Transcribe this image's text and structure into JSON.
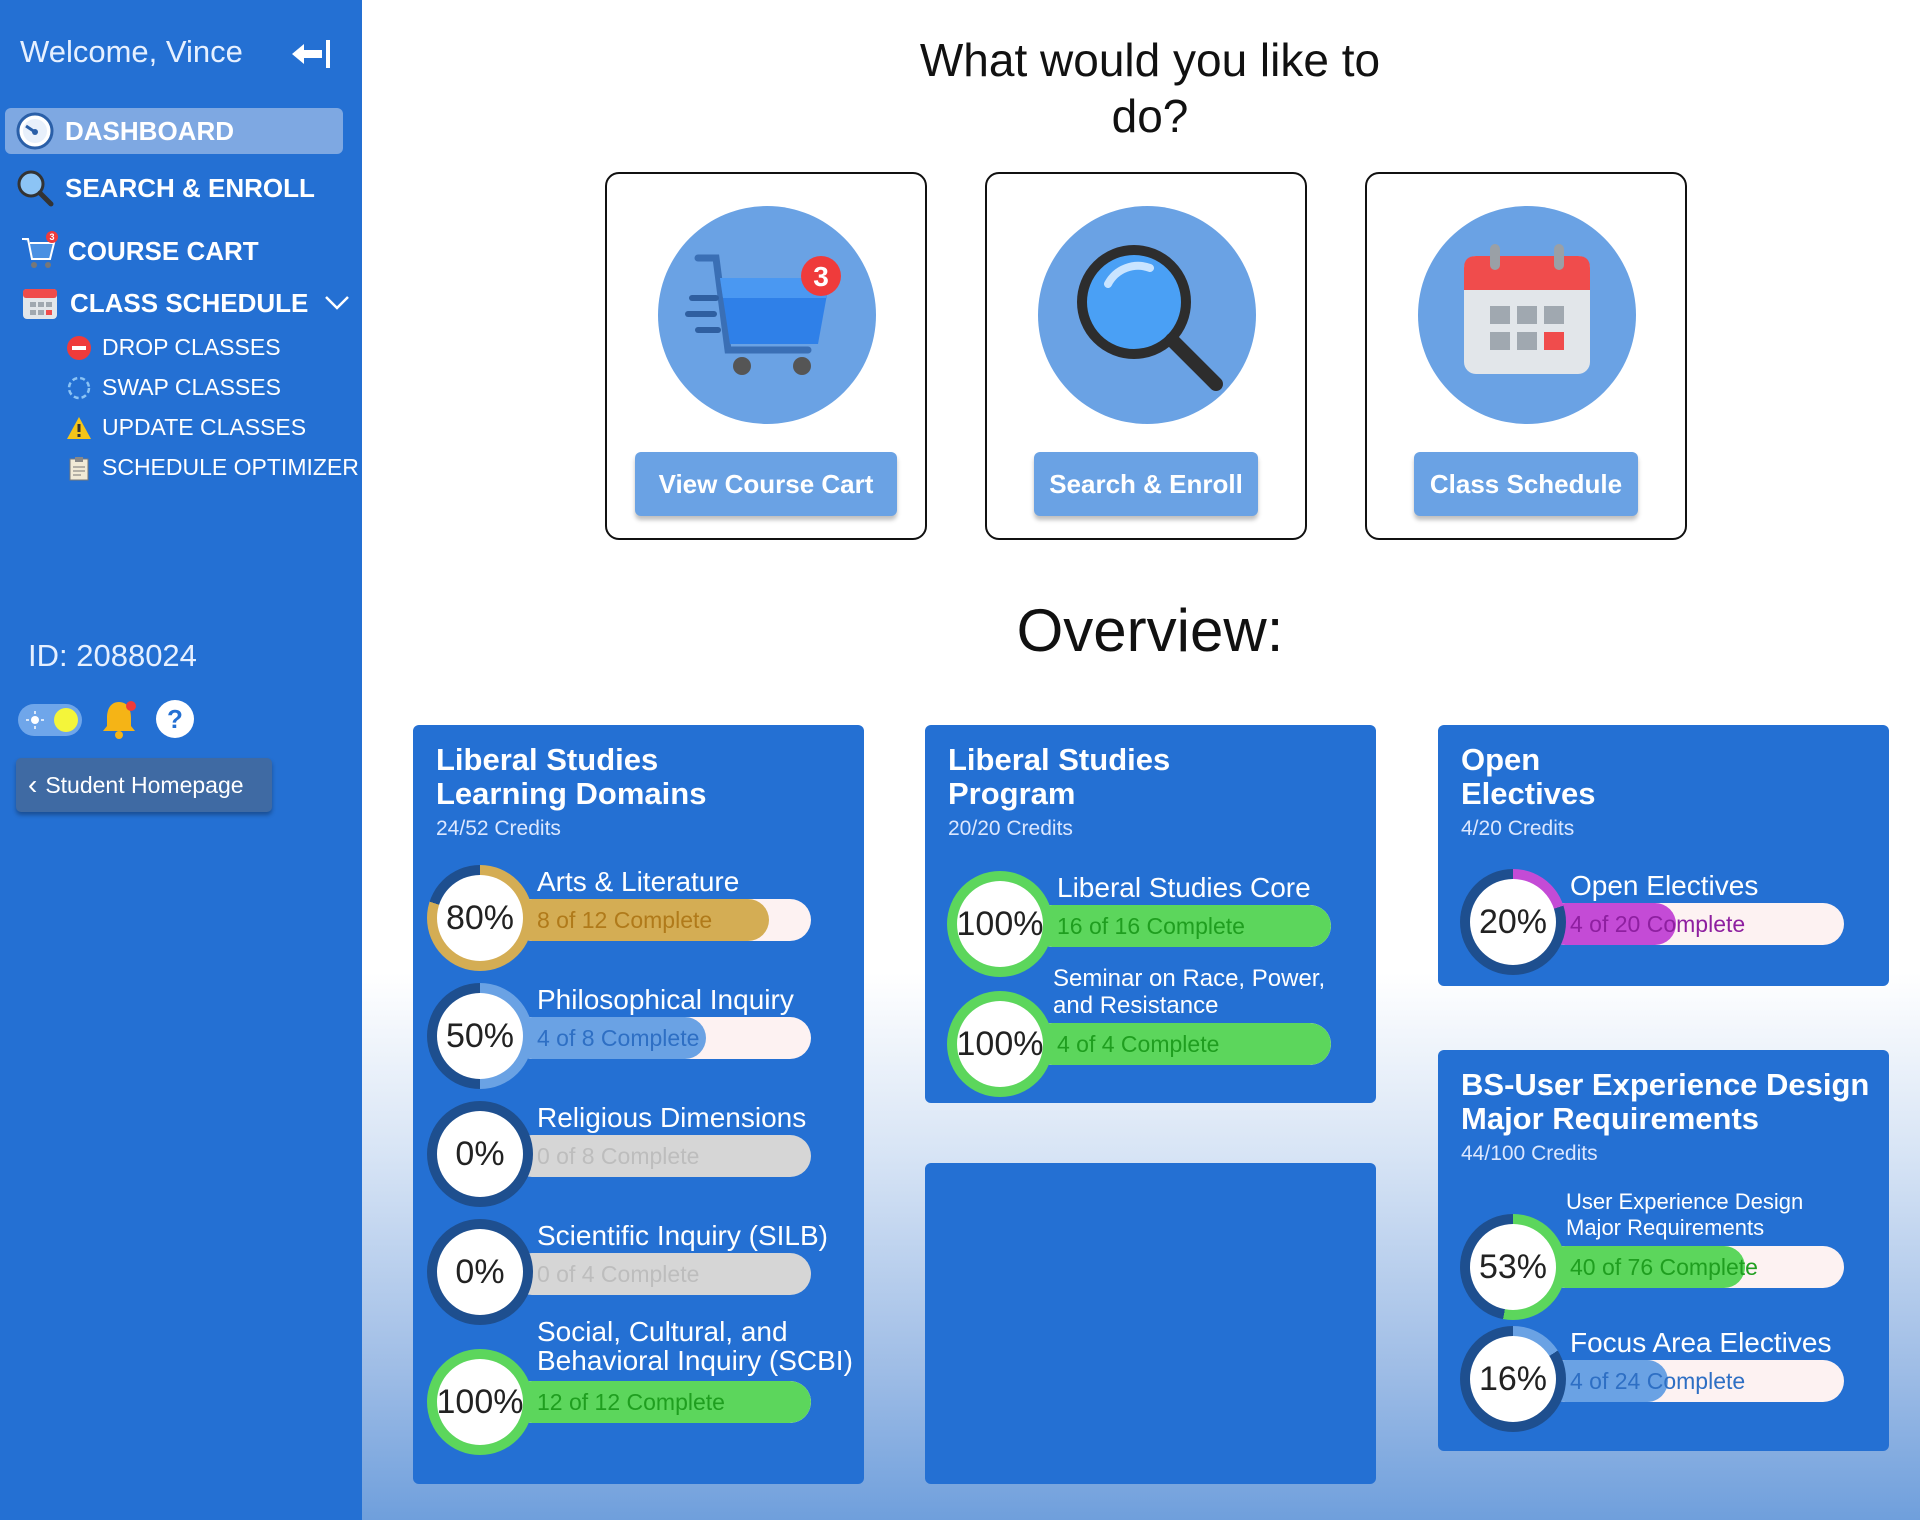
{
  "sidebar": {
    "welcome": "Welcome, Vince",
    "nav": {
      "dashboard": "DASHBOARD",
      "search_enroll": "SEARCH & ENROLL",
      "course_cart": "COURSE CART",
      "class_schedule": "CLASS SCHEDULE",
      "drop_classes": "DROP CLASSES",
      "swap_classes": "SWAP CLASSES",
      "update_classes": "UPDATE CLASSES",
      "schedule_optimizer": "SCHEDULE OPTIMIZER"
    },
    "cart_badge": "3",
    "student_id": "ID: 2088024",
    "help_label": "?",
    "home_button": "Student Homepage"
  },
  "main": {
    "title": "What would you like to do?",
    "cart_badge": "3",
    "actions": {
      "cart": "View Course Cart",
      "search": "Search & Enroll",
      "schedule": "Class Schedule"
    },
    "overview_title": "Overview:"
  },
  "panels": {
    "lsld": {
      "title_1": "Liberal Studies",
      "title_2": "Learning Domains",
      "credits": "24/52 Credits",
      "items": [
        {
          "label": "Arts & Literature",
          "pct_text": "80%",
          "progress_text": "8 of 12 Complete",
          "pct": 80
        },
        {
          "label": "Philosophical Inquiry",
          "pct_text": "50%",
          "progress_text": "4 of 8 Complete",
          "pct": 50
        },
        {
          "label": "Religious Dimensions",
          "pct_text": "0%",
          "progress_text": "0 of 8 Complete",
          "pct": 0
        },
        {
          "label": "Scientific Inquiry (SILB)",
          "pct_text": "0%",
          "progress_text": "0 of 4 Complete",
          "pct": 0
        },
        {
          "label_1": "Social, Cultural, and",
          "label_2": "Behavioral Inquiry (SCBI)",
          "pct_text": "100%",
          "progress_text": "12 of 12 Complete",
          "pct": 100
        }
      ]
    },
    "lsp": {
      "title_1": "Liberal Studies",
      "title_2": "Program",
      "credits": "20/20 Credits",
      "items": [
        {
          "label": "Liberal Studies Core",
          "pct_text": "100%",
          "progress_text": "16 of 16 Complete",
          "pct": 100
        },
        {
          "label_1": "Seminar on Race, Power,",
          "label_2": "and Resistance",
          "pct_text": "100%",
          "progress_text": "4 of 4 Complete",
          "pct": 100
        }
      ]
    },
    "oe": {
      "title_1": "Open",
      "title_2": "Electives",
      "credits": "4/20 Credits",
      "items": [
        {
          "label": "Open Electives",
          "pct_text": "20%",
          "progress_text": "4 of 20 Complete",
          "pct": 20
        }
      ]
    },
    "bs": {
      "title_1": "BS-User Experience Design",
      "title_2": "Major Requirements",
      "credits": "44/100 Credits",
      "items": [
        {
          "label_1": "User Experience Design",
          "label_2": "Major Requirements",
          "pct_text": "53%",
          "progress_text": "40 of 76 Complete",
          "pct": 53
        },
        {
          "label": "Focus Area Electives",
          "pct_text": "16%",
          "progress_text": "4 of 24 Complete",
          "pct": 16
        }
      ]
    }
  },
  "colors": {
    "sidebar": "#2470d3",
    "panel": "#2470d3",
    "action_circle": "#6aa2e4",
    "gold": "#d4ad54",
    "light_blue": "#6aa2e4",
    "green": "#5cd65c",
    "purple": "#c44bd6",
    "grey": "#d6d6d6",
    "bar_bg": "#fdf2f2",
    "badge_red": "#ef3b3b"
  }
}
